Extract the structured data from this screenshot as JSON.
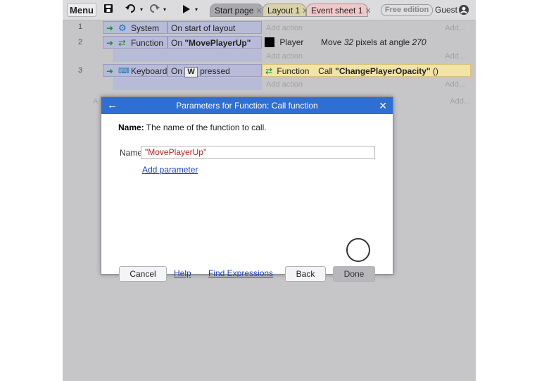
{
  "toolbar": {
    "menu_label": "Menu",
    "tabs": [
      {
        "label": "Start page"
      },
      {
        "label": "Layout 1"
      },
      {
        "label": "Event sheet 1"
      }
    ],
    "free_edition": "Free edition",
    "guest": "Guest"
  },
  "events": [
    {
      "number": "1",
      "object": "System",
      "condition": "On start of layout",
      "add_action": "Add action",
      "add_right": "Add..."
    },
    {
      "number": "2",
      "object": "Function",
      "condition_prefix": "On ",
      "condition_strong": "\"MovePlayerUp\"",
      "action_object": "Player",
      "action_text_prefix": "Move ",
      "action_em1": "32",
      "action_text_mid": " pixels at angle ",
      "action_em2": "270",
      "add_action": "Add action",
      "add_right": "Add..."
    },
    {
      "number": "3",
      "object": "Keyboard",
      "condition_on": "On",
      "condition_key": "W",
      "condition_suffix": "pressed",
      "action_object": "Function",
      "action_prefix": "Call ",
      "action_strong": "\"ChangePlayerOpacity\"",
      "action_suffix": " ()",
      "add_action": "Add action",
      "add_right": "Add..."
    }
  ],
  "row_add_left": "A",
  "row_add_right": "Add...",
  "dialog": {
    "title": "Parameters for Function: Call function",
    "desc_strong": "Name:",
    "desc_text": " The name of the function to call.",
    "name_label": "Name",
    "name_value": "\"MovePlayerUp\"",
    "add_parameter": "Add parameter",
    "cancel": "Cancel",
    "help": "Help",
    "find_expressions": "Find Expressions",
    "back": "Back",
    "done": "Done"
  }
}
